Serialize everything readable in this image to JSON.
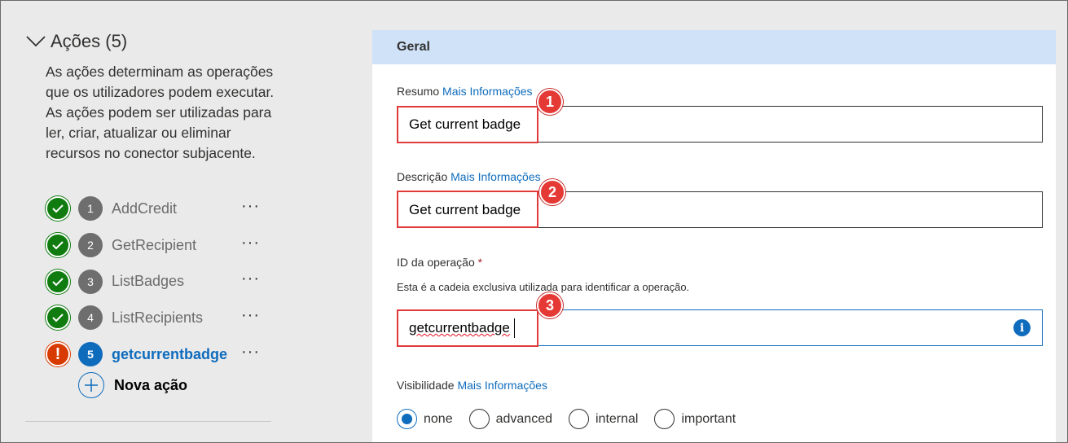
{
  "sidebar": {
    "section_title": "Ações (5)",
    "description": "As ações determinam as operações que os utilizadores podem executar. As ações podem ser utilizadas para ler, criar, atualizar ou eliminar recursos no conector subjacente.",
    "actions": [
      {
        "number": "1",
        "label": "AddCredit",
        "status": "ok",
        "more": "···"
      },
      {
        "number": "2",
        "label": "GetRecipient",
        "status": "ok",
        "more": "···"
      },
      {
        "number": "3",
        "label": "ListBadges",
        "status": "ok",
        "more": "···"
      },
      {
        "number": "4",
        "label": "ListRecipients",
        "status": "ok",
        "more": "···"
      },
      {
        "number": "5",
        "label": "getcurrentbadge",
        "status": "error",
        "error_mark": "!",
        "more": "···"
      }
    ],
    "new_action_label": "Nova ação"
  },
  "general": {
    "title": "Geral",
    "summary": {
      "label": "Resumo",
      "link": "Mais Informações",
      "value": "Get current badge",
      "callout": "1"
    },
    "description": {
      "label": "Descrição",
      "link": "Mais Informações",
      "value": "Get current badge",
      "callout": "2"
    },
    "operation_id": {
      "label": "ID da operação",
      "required_mark": "*",
      "hint": "Esta é a cadeia exclusiva utilizada para identificar a operação.",
      "value": "getcurrentbadge",
      "callout": "3",
      "info_glyph": "i"
    },
    "visibility": {
      "label": "Visibilidade",
      "link": "Mais Informações",
      "options": [
        "none",
        "advanced",
        "internal",
        "important"
      ],
      "selected": "none"
    }
  },
  "colors": {
    "accent": "#0f6cbd",
    "success": "#107c10",
    "error": "#d83b01",
    "callout": "#e53935",
    "header_band": "#cfe2f8"
  },
  "icons": [
    "chevron-down-icon",
    "check-icon",
    "error-icon",
    "more-icon",
    "add-icon",
    "info-icon"
  ]
}
